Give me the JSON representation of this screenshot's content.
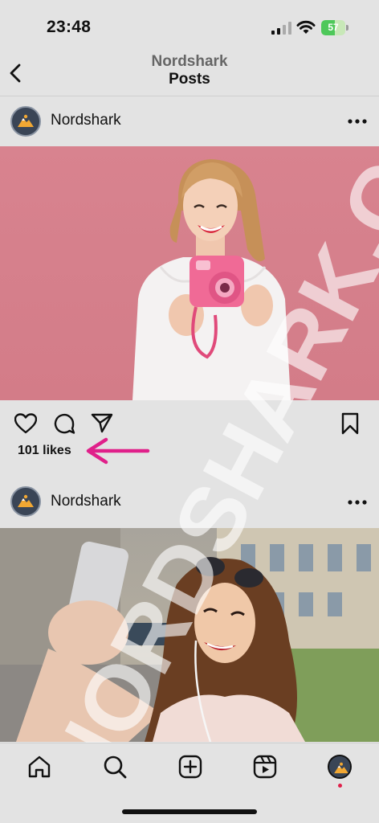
{
  "status_bar": {
    "time": "23:48",
    "battery_level": "57",
    "battery_percent": 57
  },
  "header": {
    "account": "Nordshark",
    "title": "Posts"
  },
  "posts": [
    {
      "username": "Nordshark",
      "likes": "101 likes"
    },
    {
      "username": "Nordshark"
    }
  ],
  "watermark": {
    "text": "NORDSHARK.COM"
  },
  "colors": {
    "annotation_arrow": "#e0208a",
    "battery_green": "#4ec85a",
    "notification_dot": "#e0204a"
  },
  "tab_bar": {
    "items": [
      "home-icon",
      "search-icon",
      "create-icon",
      "reels-icon",
      "profile-avatar"
    ]
  }
}
